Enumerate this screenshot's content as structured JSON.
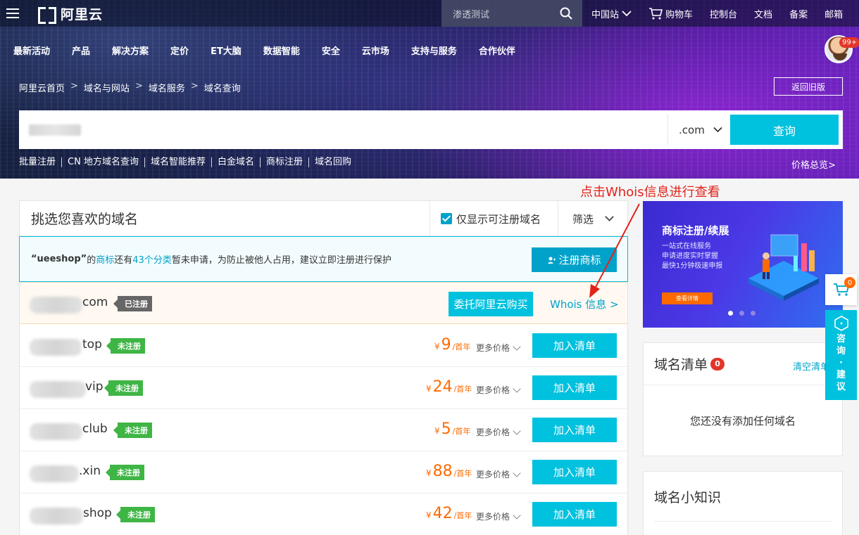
{
  "topnav": {
    "logo_text": "阿里云",
    "search_placeholder": "渗透测试",
    "links": [
      "中国站",
      "购物车",
      "控制台",
      "文档",
      "备案",
      "邮箱"
    ]
  },
  "secnav": [
    "最新活动",
    "产品",
    "解决方案",
    "定价",
    "ET大脑",
    "数据智能",
    "安全",
    "云市场",
    "支持与服务",
    "合作伙伴"
  ],
  "avatar_badge": "99+",
  "breadcrumb": [
    "阿里云首页",
    "域名与网站",
    "域名服务",
    "域名查询"
  ],
  "breadcrumb_sep": ">",
  "back_old": "返回旧版",
  "domain_search": {
    "tld": ".com",
    "query_label": "查询"
  },
  "quicklinks": [
    "批量注册",
    "CN 地方域名查询",
    "域名智能推荐",
    "白金域名",
    "商标注册",
    "域名回购"
  ],
  "price_overview": "价格总览>",
  "annotation": "点击Whois信息进行查看",
  "list": {
    "title": "挑选您喜欢的域名",
    "only_available": "仅显示可注册域名",
    "filter": "筛选",
    "notice": {
      "quote": "“ueeshop”",
      "t1": "的",
      "trademark": "商标",
      "t2": "还有",
      "categories": "43个分类",
      "t3": "暂未申请，为防止被他人占用，建议立即注册进行保护",
      "button": "注册商标"
    },
    "registered": {
      "suffix": "com",
      "tag": "已注册",
      "entrust": "委托阿里云购买",
      "whois": "Whois 信息 >"
    },
    "rows": [
      {
        "suffix": "top",
        "tag": "未注册",
        "price": "9",
        "unit": "/首年"
      },
      {
        "suffix": "vip",
        "tag": "未注册",
        "price": "24",
        "unit": "/首年"
      },
      {
        "suffix": "club",
        "tag": "未注册",
        "price": "5",
        "unit": "/首年"
      },
      {
        "suffix": ".xin",
        "tag": "未注册",
        "price": "88",
        "unit": "/首年"
      },
      {
        "suffix": "shop",
        "tag": "未注册",
        "price": "42",
        "unit": "/首年"
      }
    ],
    "currency": "¥",
    "more_price": "更多价格",
    "add_label": "加入清单"
  },
  "promo": {
    "title": "商标注册/续展",
    "lines": [
      "一站式在线服务",
      "申请进度实时掌握",
      "最快1分钟极速申报"
    ],
    "button": "查看详情"
  },
  "cart": {
    "title": "域名清单",
    "count": "0",
    "clear": "清空清单",
    "empty": "您还没有添加任何域名"
  },
  "knowledge": {
    "title": "域名小知识"
  },
  "float": {
    "cart_count": "0",
    "consult": [
      "咨",
      "询",
      "·",
      "建",
      "议"
    ]
  }
}
